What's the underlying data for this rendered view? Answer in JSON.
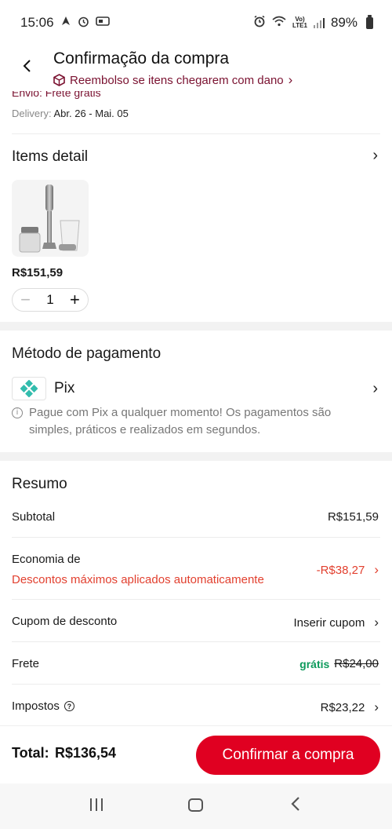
{
  "status_bar": {
    "time": "15:06",
    "battery": "89%",
    "lte_top": "Vo)",
    "lte_bottom": "LTE1",
    "left_icons": [
      "navigation-icon",
      "clock-arrow-icon",
      "key-icon"
    ],
    "right_icons": [
      "alarm-icon",
      "wifi-icon",
      "signal-icon",
      "battery-icon"
    ]
  },
  "header": {
    "title": "Confirmação da compra",
    "refund_text": "Reembolso se itens chegarem com dano",
    "refund_chevron": "›"
  },
  "shipping": {
    "free_label": "Envio: Frete grátis",
    "delivery_label": "Delivery:",
    "delivery_dates": "Abr. 26 - Mai. 05"
  },
  "items": {
    "title": "Items detail",
    "price": "R$151,59",
    "quantity": "1",
    "minus": "−",
    "plus": "+"
  },
  "payment": {
    "title": "Método de pagamento",
    "method": "Pix",
    "info": "Pague com Pix a qualquer momento! Os pagamentos são simples, práticos e realizados em segundos."
  },
  "summary": {
    "title": "Resumo",
    "subtotal_label": "Subtotal",
    "subtotal_value": "R$151,59",
    "savings_label": "Economia de",
    "savings_note": "Descontos máximos aplicados automaticamente",
    "savings_value": "-R$38,27",
    "coupon_label": "Cupom de desconto",
    "coupon_value": "Inserir cupom",
    "shipping_label": "Frete",
    "shipping_free": "grátis",
    "shipping_original": "R$24,00",
    "taxes_label": "Impostos",
    "taxes_value": "R$23,22"
  },
  "footer": {
    "total_label": "Total:",
    "total_value": "R$136,54",
    "confirm_button": "Confirmar a compra"
  },
  "colors": {
    "brand_red": "#e00021",
    "savings_red": "#e2402f",
    "free_green": "#0c9a5b",
    "refund_maroon": "#7a1130",
    "pix_teal": "#32bcad"
  }
}
